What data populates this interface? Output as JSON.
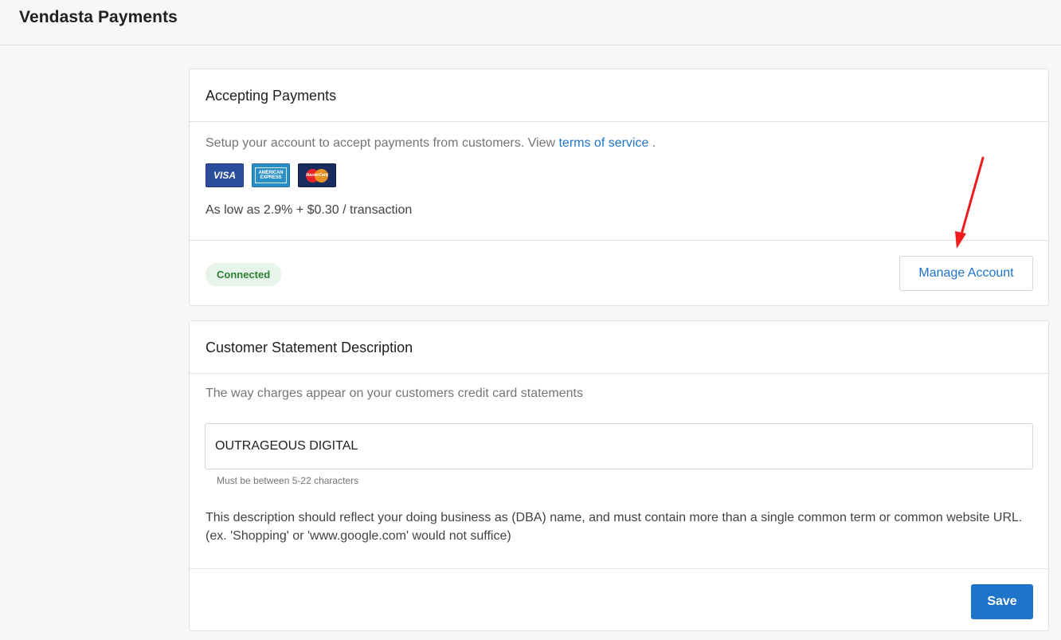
{
  "header": {
    "title": "Vendasta Payments"
  },
  "accepting_payments": {
    "title": "Accepting Payments",
    "setup_text": "Setup your account to accept payments from customers. View ",
    "terms_link": "terms of service",
    "setup_suffix": " .",
    "cards": [
      {
        "label": "VISA",
        "icon": "visa-icon"
      },
      {
        "label": "AMERICAN EXPRESS",
        "icon": "american-express-icon"
      },
      {
        "label": "MasterCard",
        "icon": "mastercard-icon"
      }
    ],
    "fee_text": "As low as 2.9% + $0.30 / transaction",
    "status_badge": "Connected",
    "manage_button": "Manage Account"
  },
  "statement": {
    "title": "Customer Statement Description",
    "description": "The way charges appear on your customers credit card statements",
    "input_value": "OUTRAGEOUS DIGITAL",
    "hint": "Must be between 5-22 characters",
    "note": "This description should reflect your doing business as (DBA) name, and must contain more than a single common term or common website URL. (ex. 'Shopping' or 'www.google.com' would not suffice)",
    "save_button": "Save"
  },
  "colors": {
    "accent": "#1e74c8",
    "connected_bg": "#e6f4ea",
    "connected_text": "#2e7d32",
    "annotation_arrow": "#ee1c1c"
  }
}
